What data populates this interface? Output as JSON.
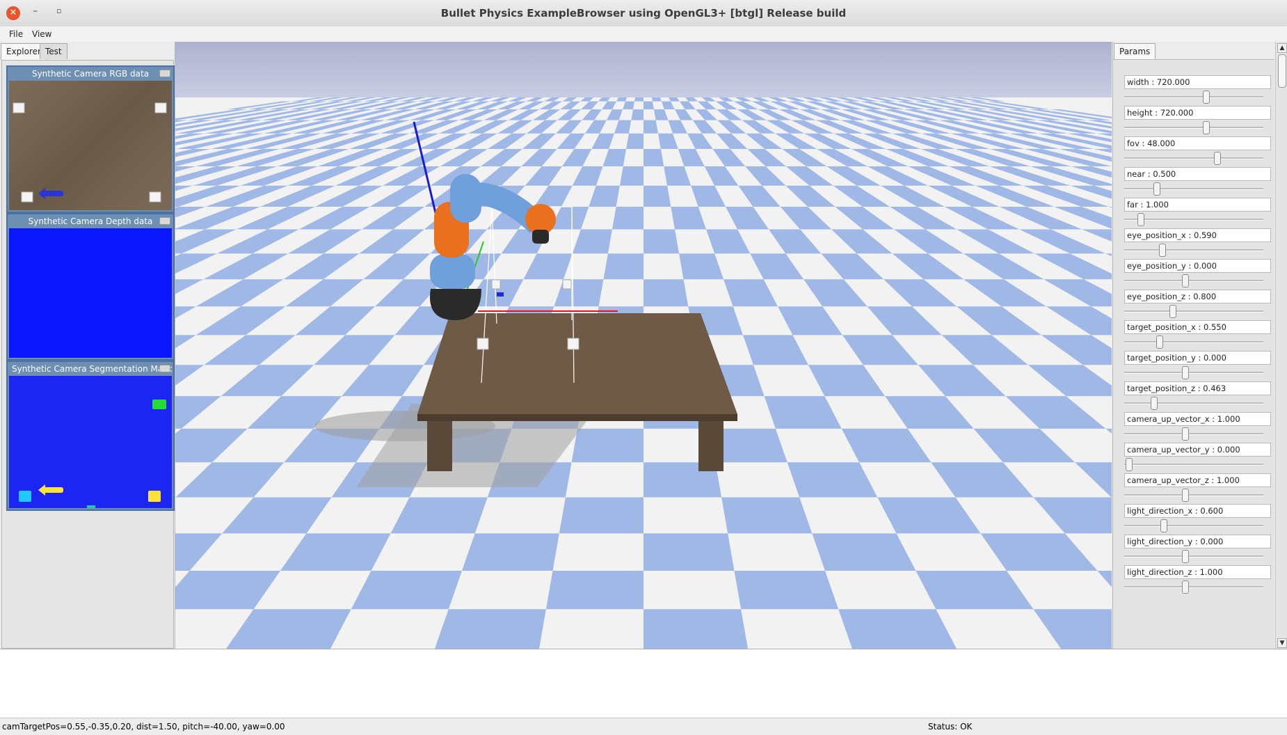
{
  "window": {
    "title": "Bullet Physics ExampleBrowser using OpenGL3+ [btgl] Release build",
    "close_glyph": "✕",
    "minimize_glyph": "–",
    "maximize_glyph": "▫"
  },
  "menu": {
    "items": [
      "File",
      "View"
    ]
  },
  "left_panel": {
    "tabs": [
      "Explorer",
      "Test"
    ],
    "camera_windows": [
      {
        "title": "Synthetic Camera RGB data"
      },
      {
        "title": "Synthetic Camera Depth data"
      },
      {
        "title": "Synthetic Camera Segmentation Mask"
      }
    ]
  },
  "right_panel": {
    "tab": "Params",
    "params": [
      {
        "label": "width : 720.000",
        "slider_fraction": 0.59
      },
      {
        "label": "height : 720.000",
        "slider_fraction": 0.59
      },
      {
        "label": "fov : 48.000",
        "slider_fraction": 0.67
      },
      {
        "label": "near : 0.500",
        "slider_fraction": 0.22
      },
      {
        "label": "far : 1.000",
        "slider_fraction": 0.1
      },
      {
        "label": "eye_position_x : 0.590",
        "slider_fraction": 0.26
      },
      {
        "label": "eye_position_y : 0.000",
        "slider_fraction": 0.43
      },
      {
        "label": "eye_position_z : 0.800",
        "slider_fraction": 0.34
      },
      {
        "label": "target_position_x : 0.550",
        "slider_fraction": 0.24
      },
      {
        "label": "target_position_y : 0.000",
        "slider_fraction": 0.43
      },
      {
        "label": "target_position_z : 0.463",
        "slider_fraction": 0.2
      },
      {
        "label": "camera_up_vector_x : 1.000",
        "slider_fraction": 0.43
      },
      {
        "label": "camera_up_vector_y : 0.000",
        "slider_fraction": 0.01
      },
      {
        "label": "camera_up_vector_z : 1.000",
        "slider_fraction": 0.43
      },
      {
        "label": "light_direction_x : 0.600",
        "slider_fraction": 0.27
      },
      {
        "label": "light_direction_y : 0.000",
        "slider_fraction": 0.43
      },
      {
        "label": "light_direction_z : 1.000",
        "slider_fraction": 0.43
      }
    ]
  },
  "status": {
    "camera": "camTargetPos=0.55,-0.35,0.20, dist=1.50, pitch=-40.00, yaw=0.00",
    "state": "Status: OK"
  },
  "colors": {
    "sky": "#aeb3cf",
    "floor_blue": "#9fb8e6",
    "floor_white": "#f2f2f2",
    "robot_blue": "#6fa0dc",
    "robot_orange": "#e8701e",
    "table": "#6e5a45",
    "depth_blue": "#0a16ff",
    "seg_blue": "#1c25f2"
  },
  "icons": {
    "close": "close-icon",
    "minimize": "minimize-icon",
    "maximize": "maximize-icon"
  }
}
